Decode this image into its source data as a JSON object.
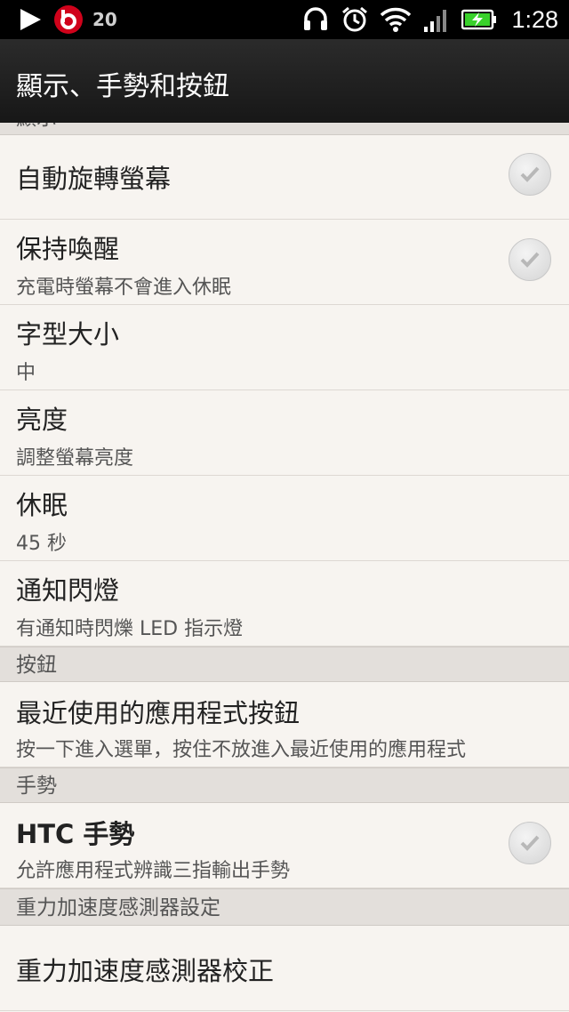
{
  "status_bar": {
    "notification_count": "20",
    "time": "1:28",
    "icons": [
      "play-icon",
      "beats-icon",
      "headset-icon",
      "alarm-icon",
      "wifi-icon",
      "signal-icon",
      "battery-charging-icon"
    ]
  },
  "header": {
    "title": "顯示、手勢和按鈕"
  },
  "sections": {
    "top_partial": "顯示",
    "buttons": "按鈕",
    "gestures": "手勢",
    "gsensor": "重力加速度感測器設定"
  },
  "rows": {
    "auto_rotate": {
      "title": "自動旋轉螢幕",
      "checked": true
    },
    "stay_awake": {
      "title": "保持喚醒",
      "subtitle": "充電時螢幕不會進入休眠",
      "checked": true
    },
    "font_size": {
      "title": "字型大小",
      "subtitle": "中"
    },
    "brightness": {
      "title": "亮度",
      "subtitle": "調整螢幕亮度"
    },
    "sleep": {
      "title": "休眠",
      "subtitle": "45 秒"
    },
    "notification_flash": {
      "title": "通知閃燈",
      "subtitle": "有通知時閃爍 LED 指示燈"
    },
    "recent_apps_button": {
      "title": "最近使用的應用程式按鈕",
      "subtitle": "按一下進入選單，按住不放進入最近使用的應用程式"
    },
    "htc_gestures": {
      "title": "HTC 手勢",
      "subtitle": "允許應用程式辨識三指輸出手勢",
      "checked": true
    },
    "gsensor_calibration": {
      "title": "重力加速度感測器校正"
    }
  },
  "colors": {
    "background": "#f7f4f0",
    "section_header": "#e3dfdb",
    "title_bar": "#1e1e1e",
    "status_bar": "#000000",
    "beats_red": "#d0021b",
    "battery_green": "#39d12b"
  }
}
